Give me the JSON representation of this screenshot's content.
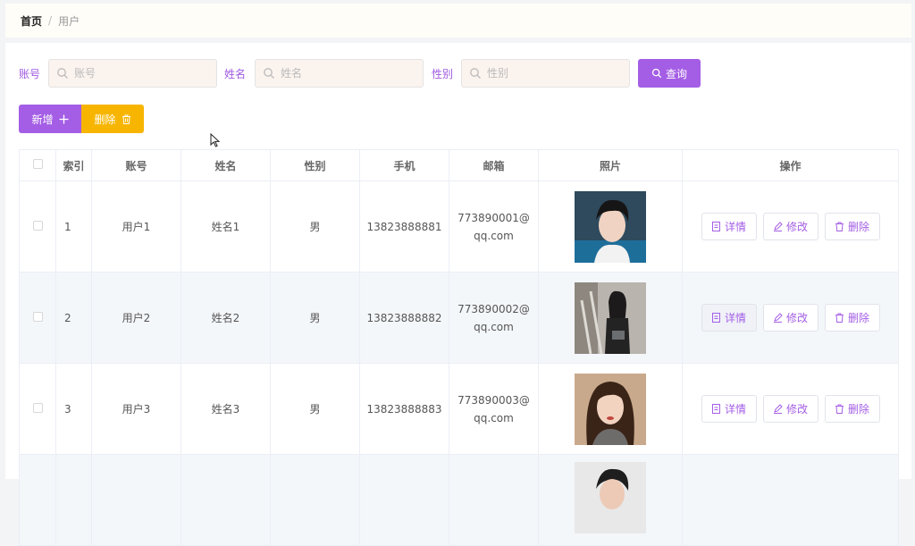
{
  "breadcrumb": {
    "home": "首页",
    "separator": "/",
    "current": "用户"
  },
  "search": {
    "account_label": "账号",
    "account_placeholder": "账号",
    "name_label": "姓名",
    "name_placeholder": "姓名",
    "gender_label": "性别",
    "gender_placeholder": "性别",
    "query_label": "查询"
  },
  "toolbar": {
    "add_label": "新增",
    "delete_label": "删除"
  },
  "table": {
    "headers": [
      "索引",
      "账号",
      "姓名",
      "性别",
      "手机",
      "邮箱",
      "照片",
      "操作"
    ],
    "rows": [
      {
        "index": "1",
        "account": "用户1",
        "name": "姓名1",
        "gender": "男",
        "phone": "13823888881",
        "email": "773890001@qq.com"
      },
      {
        "index": "2",
        "account": "用户2",
        "name": "姓名2",
        "gender": "男",
        "phone": "13823888882",
        "email": "773890002@qq.com"
      },
      {
        "index": "3",
        "account": "用户3",
        "name": "姓名3",
        "gender": "男",
        "phone": "13823888883",
        "email": "773890003@qq.com"
      }
    ],
    "actions": {
      "detail": "详情",
      "edit": "修改",
      "delete": "删除"
    }
  },
  "colors": {
    "accent": "#a45ee5",
    "warning": "#f7b500"
  }
}
